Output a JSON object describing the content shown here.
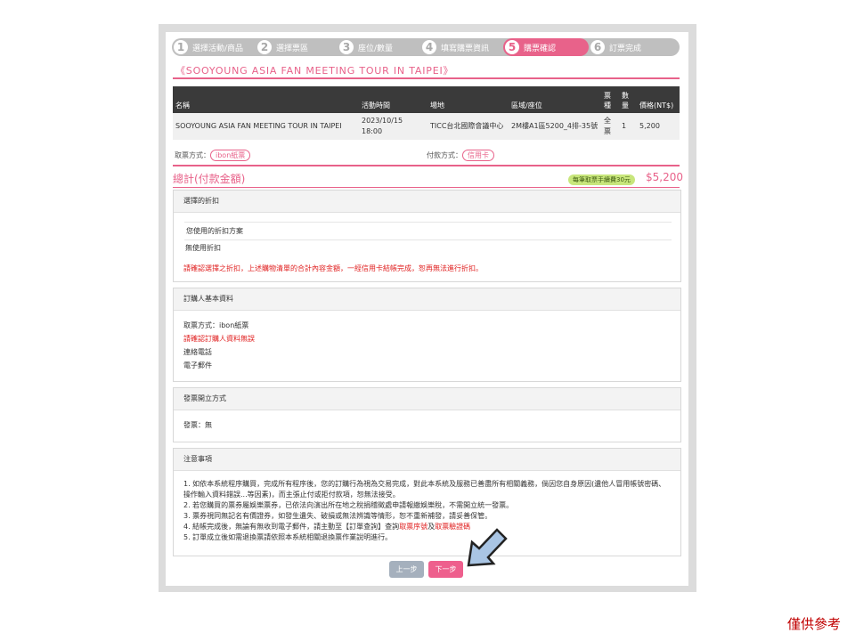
{
  "steps": [
    {
      "num": "1",
      "label": "選擇活動/商品"
    },
    {
      "num": "2",
      "label": "選擇票區"
    },
    {
      "num": "3",
      "label": "座位/數量"
    },
    {
      "num": "4",
      "label": "填寫購票資訊"
    },
    {
      "num": "5",
      "label": "購票確認"
    },
    {
      "num": "6",
      "label": "訂票完成"
    }
  ],
  "event_title": "《SOOYOUNG ASIA FAN MEETING TOUR IN TAIPEI》",
  "table": {
    "headers": {
      "name": "名稱",
      "time": "活動時間",
      "venue": "場地",
      "seat": "區域/座位",
      "type": "票種",
      "qty": "數量",
      "price": "價格(NT$)"
    },
    "row": {
      "name": "SOOYOUNG ASIA FAN MEETING TOUR IN TAIPEI",
      "time": "2023/10/15 18:00",
      "venue": "TICC台北國際會議中心",
      "seat": "2M樓A1區5200_4排-35號",
      "type": "全票",
      "qty": "1",
      "price": "5,200"
    }
  },
  "pickup": {
    "label": "取票方式：",
    "value": "ibon紙票"
  },
  "payment": {
    "label": "付款方式：",
    "value": "信用卡"
  },
  "total": {
    "label": "總計(付款金額)",
    "fee_note": "每筆取票手續費30元",
    "amount": "$5,200"
  },
  "discount": {
    "title": "選擇的折扣",
    "subtitle": "您使用的折扣方案",
    "value": "無使用折扣",
    "warning": "請確認選擇之折扣，上述購物清單的合計內容金額，一經信用卡結帳完成，恕再無法進行折扣。"
  },
  "buyer": {
    "title": "訂購人基本資料",
    "pickup": "取票方式：ibon紙票",
    "confirm": "請確認訂購人資料無誤",
    "phone": "連絡電話",
    "email": "電子郵件"
  },
  "invoice": {
    "title": "發票開立方式",
    "value": "發票：無"
  },
  "notes": {
    "title": "注意事項",
    "n1": "1. 如依本系統程序購買，完成所有程序後，您的訂購行為視為交易完成，對此本系統及服務已善盡所有相關義務，倘因您自身原因(遺他人冒用帳號密碼、操作輸入資料錯誤...等因素)，而主張止付或拒付款項，恕無法接受。",
    "n2": "2. 若您購買的票券屬娛樂票券，已依法向演出所在地之稅捐稽徵處申請報繳娛樂稅，不需開立統一發票。",
    "n3": "3. 票券視同無記名有價證券，如發生遺失、破損或無法辨識等情形，恕不重新補發，請妥善保管。",
    "n4a": "4. 結帳完成後，無論有無收到電子郵件，請主動至【訂單查詢】查詢",
    "n4b": "取票序號",
    "n4c": "及",
    "n4d": "取票驗證碼",
    "n5": "5. 訂單成立後如需退換票請依照本系統相關退換票作業說明進行。"
  },
  "buttons": {
    "prev": "上一步",
    "next": "下一步"
  },
  "watermark": "僅供參考",
  "colors": {
    "accent": "#e8628a",
    "warning": "#e02020",
    "fee_badge": "#c8e67c",
    "arrow": "#a9c5e4"
  }
}
